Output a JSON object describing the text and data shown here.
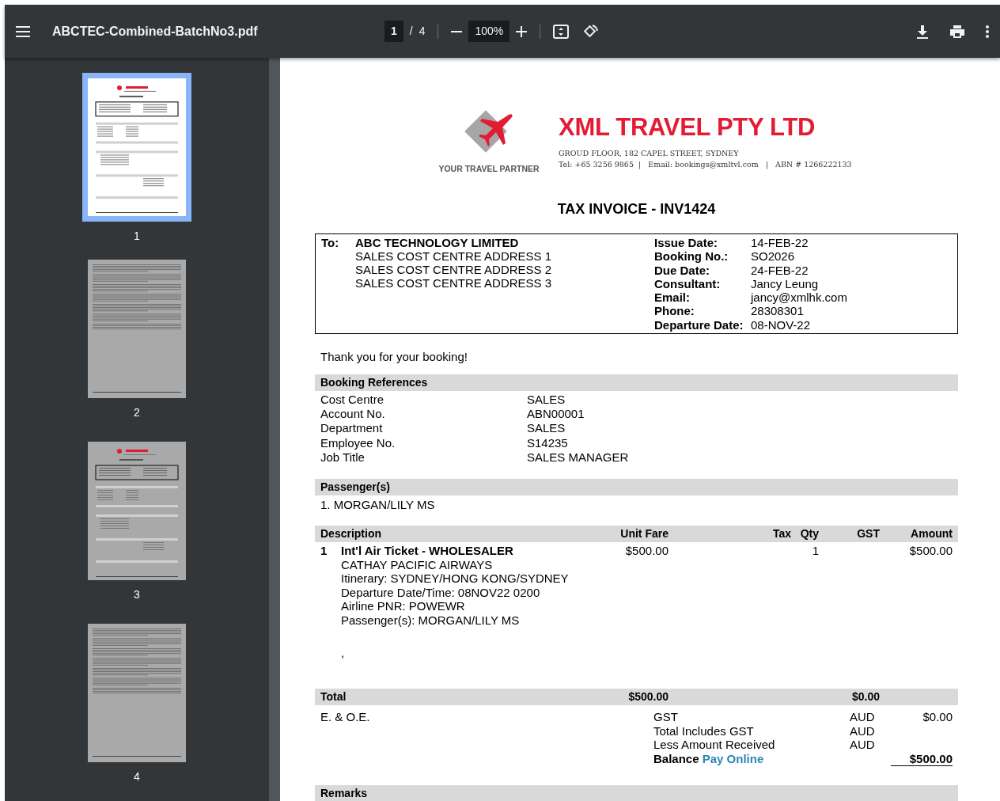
{
  "toolbar": {
    "file_name": "ABCTEC-Combined-BatchNo3.pdf",
    "page_input": "1",
    "page_separator": "/",
    "page_count": "4",
    "zoom": "100%"
  },
  "thumbnails": [
    {
      "label": "1",
      "selected": true,
      "kind": "invoice"
    },
    {
      "label": "2",
      "selected": false,
      "kind": "text"
    },
    {
      "label": "3",
      "selected": false,
      "kind": "invoice"
    },
    {
      "label": "4",
      "selected": false,
      "kind": "text"
    }
  ],
  "document": {
    "company": {
      "name": "XML TRAVEL PTY LTD",
      "tagline": "YOUR TRAVEL PARTNER",
      "address": "GROUD FLOOR, 182 CAPEL STREET, SYDNEY",
      "contact": "Tel: +65 3256 9865  |   Email: bookings@xmltvl.com   |   ABN # 1266222133"
    },
    "title": "TAX INVOICE - INV1424",
    "to_label": "To:",
    "customer": {
      "name": "ABC TECHNOLOGY LIMITED",
      "address_lines": [
        "SALES COST CENTRE ADDRESS 1",
        "SALES COST CENTRE ADDRESS 2",
        "SALES COST CENTRE ADDRESS 3"
      ]
    },
    "details": [
      {
        "label": "Issue Date:",
        "value": "14-FEB-22"
      },
      {
        "label": "Booking No.:",
        "value": "SO2026"
      },
      {
        "label": "Due Date:",
        "value": "24-FEB-22"
      },
      {
        "label": "Consultant:",
        "value": "Jancy Leung"
      },
      {
        "label": "Email:",
        "value": "jancy@xmlhk.com"
      },
      {
        "label": "Phone:",
        "value": "28308301"
      },
      {
        "label": "Departure Date:",
        "value": "08-NOV-22"
      }
    ],
    "thanks": "Thank you for your booking!",
    "booking_references": {
      "heading": "Booking References",
      "rows": [
        {
          "label": "Cost Centre",
          "value": "SALES"
        },
        {
          "label": "Account No.",
          "value": "ABN00001"
        },
        {
          "label": "Department",
          "value": "SALES"
        },
        {
          "label": "Employee No.",
          "value": "S14235"
        },
        {
          "label": "Job Title",
          "value": "SALES MANAGER"
        }
      ]
    },
    "passengers": {
      "heading": "Passenger(s)",
      "items": [
        "1. MORGAN/LILY MS"
      ]
    },
    "line_items": {
      "columns": [
        "Description",
        "Unit Fare",
        "Tax",
        "Qty",
        "GST",
        "Amount"
      ],
      "rows": [
        {
          "number": "1",
          "title": "Int'l Air Ticket - WHOLESALER",
          "details": [
            "CATHAY PACIFIC AIRWAYS",
            "Itinerary: SYDNEY/HONG KONG/SYDNEY",
            "Departure Date/Time: 08NOV22 0200",
            "Airline PNR: POWEWR",
            "Passenger(s):  MORGAN/LILY MS"
          ],
          "note": ",",
          "unit_fare": "$500.00",
          "qty": "1",
          "amount": "$500.00"
        }
      ]
    },
    "total": {
      "label": "Total",
      "unit_fare": "$500.00",
      "gst": "$0.00"
    },
    "eoe": "E. & O.E.",
    "summary": [
      {
        "label": "GST",
        "currency": "AUD",
        "amount": "$0.00",
        "kind": "plain"
      },
      {
        "label": "Total Includes GST",
        "currency": "AUD",
        "kind": "plain"
      },
      {
        "label": "Less Amount Received",
        "currency": "AUD",
        "kind": "plain"
      },
      {
        "label": "Balance",
        "link": "Pay Online",
        "amount": "$500.00",
        "kind": "balance"
      }
    ],
    "remarks_heading": "Remarks"
  }
}
